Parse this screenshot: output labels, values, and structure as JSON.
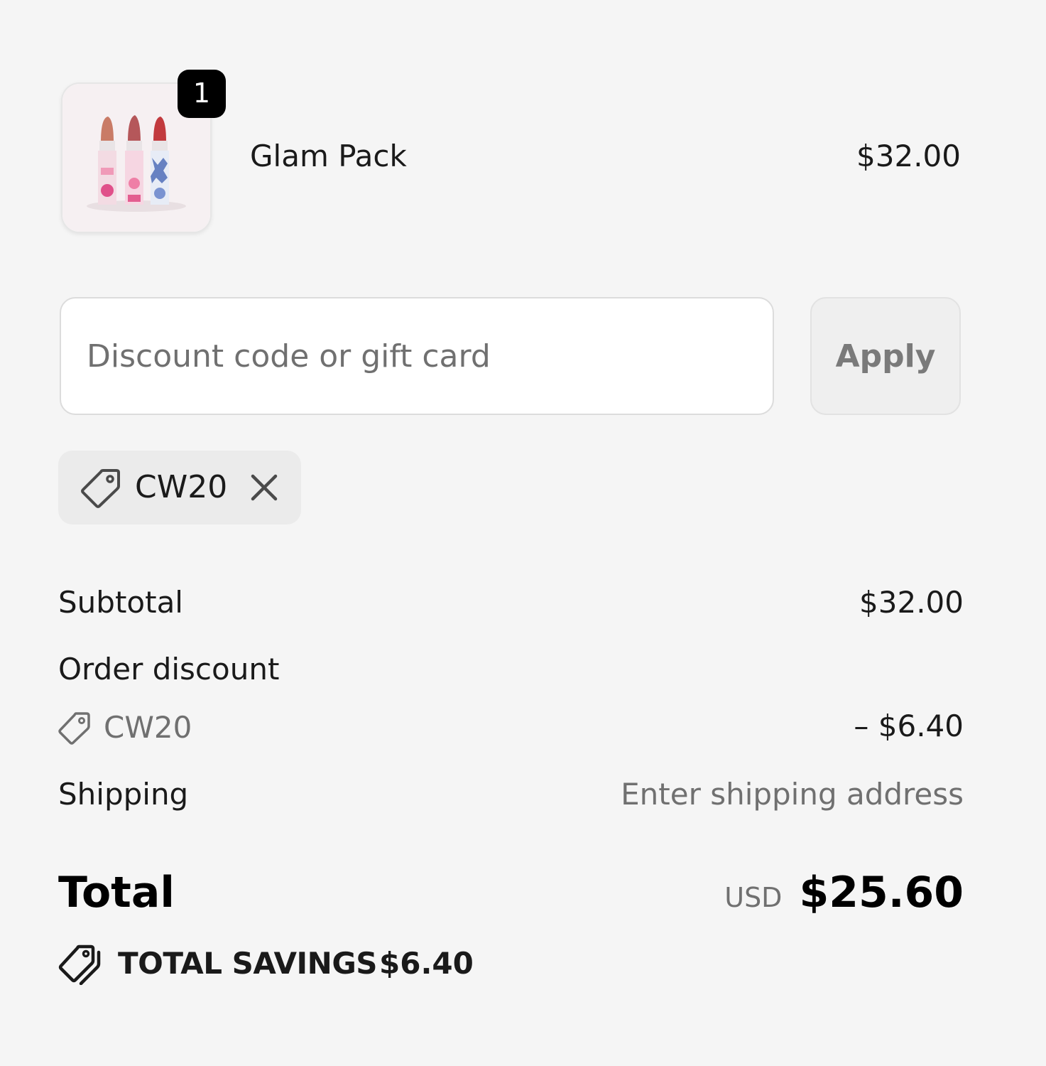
{
  "line_item": {
    "name": "Glam Pack",
    "price": "$32.00",
    "quantity": "1",
    "image_icon": "lipstick-trio-image"
  },
  "discount_form": {
    "placeholder": "Discount code or gift card",
    "value": "",
    "apply_label": "Apply"
  },
  "applied_code": {
    "code": "CW20",
    "icon": "tag-icon",
    "remove_icon": "close-icon"
  },
  "summary": {
    "subtotal_label": "Subtotal",
    "subtotal_value": "$32.00",
    "discount_label": "Order discount",
    "discount_code": "CW20",
    "discount_value": "– $6.40",
    "shipping_label": "Shipping",
    "shipping_value": "Enter shipping address"
  },
  "total": {
    "label": "Total",
    "currency": "USD",
    "amount": "$25.60"
  },
  "savings": {
    "label": "TOTAL SAVINGS",
    "amount": "$6.40",
    "icon": "tags-icon"
  },
  "colors": {
    "background": "#f5f5f5",
    "text": "#1a1a1a",
    "muted_text": "#707070",
    "badge": "#000000",
    "chip_background": "#ebebeb"
  }
}
